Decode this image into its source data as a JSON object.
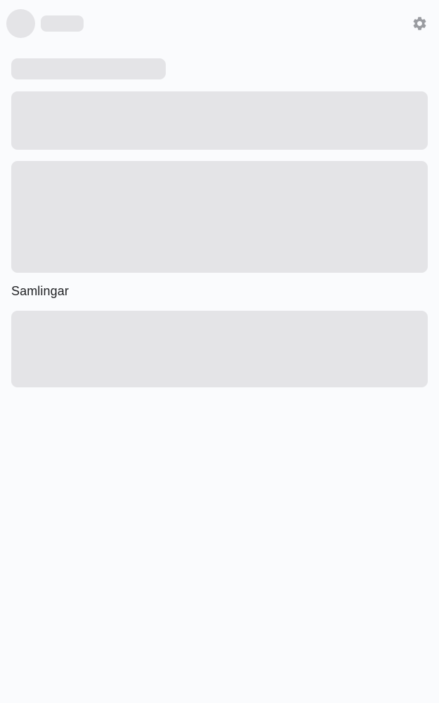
{
  "header": {
    "settings_icon": "gear-icon"
  },
  "collections": {
    "heading": "Samlingar"
  },
  "colors": {
    "background": "#fafbfd",
    "skeleton": "#e4e4e7",
    "icon": "#9a9ca1",
    "text": "#1f2023"
  }
}
